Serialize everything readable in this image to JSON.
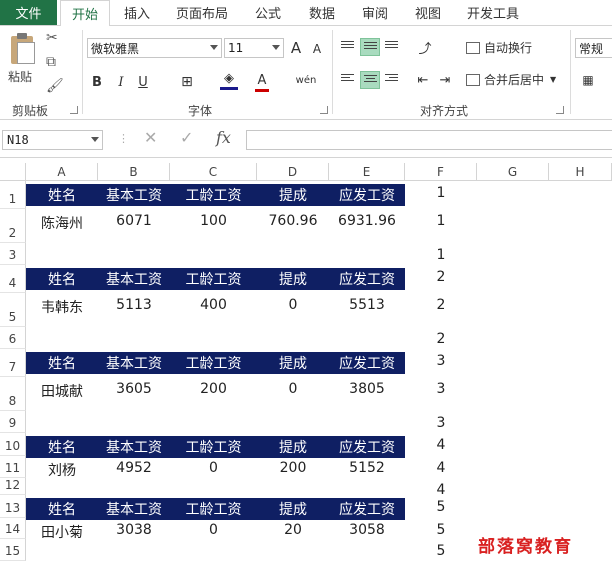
{
  "ribbon": {
    "tab_file": "文件",
    "tabs": [
      "开始",
      "插入",
      "页面布局",
      "公式",
      "数据",
      "审阅",
      "视图",
      "开发工具"
    ],
    "clipboard": {
      "paste_label": "粘贴",
      "group_label": "剪贴板"
    },
    "font": {
      "name": "微软雅黑",
      "size": "11",
      "group_label": "字体",
      "bold": "B",
      "italic": "I",
      "underline": "U",
      "grow": "A",
      "shrink": "A",
      "color_a": "A",
      "phonetic": "wén"
    },
    "alignment": {
      "wrap_text": "自动换行",
      "merge_center": "合并后居中",
      "group_label": "对齐方式"
    },
    "number": {
      "format": "常规"
    }
  },
  "formula_bar": {
    "name_box": "N18",
    "fx": "fx",
    "cancel": "✕",
    "enter": "✓",
    "formula": ""
  },
  "grid": {
    "columns": [
      "A",
      "B",
      "C",
      "D",
      "E",
      "F",
      "G",
      "H"
    ],
    "rows": [
      "1",
      "2",
      "3",
      "4",
      "5",
      "6",
      "7",
      "8",
      "9",
      "10",
      "11",
      "12",
      "13",
      "14",
      "15"
    ],
    "header": [
      "姓名",
      "基本工资",
      "工龄工资",
      "提成",
      "应发工资"
    ],
    "records": [
      [
        "陈海州",
        "6071",
        "100",
        "760.96",
        "6931.96"
      ],
      [
        "韦韩东",
        "5113",
        "400",
        "0",
        "5513"
      ],
      [
        "田城献",
        "3605",
        "200",
        "0",
        "3805"
      ],
      [
        "刘杨",
        "4952",
        "0",
        "200",
        "5152"
      ],
      [
        "田小菊",
        "3038",
        "0",
        "20",
        "3058"
      ]
    ],
    "col_f": [
      "1",
      "1",
      "1",
      "2",
      "2",
      "2",
      "3",
      "3",
      "3",
      "4",
      "4",
      "4",
      "5",
      "5",
      "5"
    ]
  },
  "watermark": "部落窝教育",
  "colors": {
    "accent": "#217346",
    "header_fill": "#0f1f63",
    "align_active": "#a9dbbf",
    "watermark": "#d92121"
  }
}
